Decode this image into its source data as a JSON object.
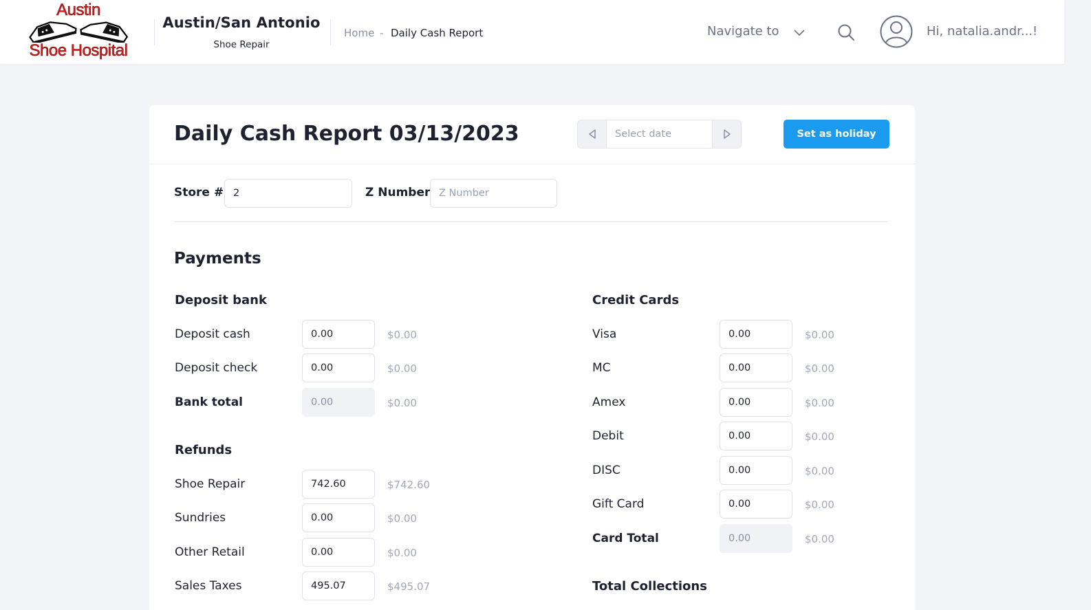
{
  "header": {
    "logo_top": "Austin",
    "logo_bottom": "Shoe Hospital",
    "brand_title": "Austin/San Antonio",
    "brand_subtitle": "Shoe Repair",
    "breadcrumb": {
      "home": "Home",
      "separator": "-",
      "current": "Daily Cash Report"
    },
    "navigate_label": "Navigate to",
    "greeting": "Hi, natalia.andr...!"
  },
  "report": {
    "title": "Daily Cash Report 03/13/2023",
    "date_placeholder": "Select date",
    "holiday_button": "Set as holiday",
    "store_label": "Store #",
    "store_value": "2",
    "z_label": "Z Number",
    "z_placeholder": "Z Number"
  },
  "payments": {
    "title": "Payments",
    "deposit_bank": {
      "title": "Deposit bank",
      "rows": [
        {
          "label": "Deposit cash",
          "value": "0.00",
          "amount": "$0.00"
        },
        {
          "label": "Deposit check",
          "value": "0.00",
          "amount": "$0.00"
        },
        {
          "label": "Bank total",
          "value": "0.00",
          "amount": "$0.00"
        }
      ]
    },
    "refunds": {
      "title": "Refunds",
      "rows": [
        {
          "label": "Shoe Repair",
          "value": "742.60",
          "amount": "$742.60"
        },
        {
          "label": "Sundries",
          "value": "0.00",
          "amount": "$0.00"
        },
        {
          "label": "Other Retail",
          "value": "0.00",
          "amount": "$0.00"
        },
        {
          "label": "Sales Taxes",
          "value": "495.07",
          "amount": "$495.07"
        }
      ]
    },
    "credit_cards": {
      "title": "Credit Cards",
      "rows": [
        {
          "label": "Visa",
          "value": "0.00",
          "amount": "$0.00"
        },
        {
          "label": "MC",
          "value": "0.00",
          "amount": "$0.00"
        },
        {
          "label": "Amex",
          "value": "0.00",
          "amount": "$0.00"
        },
        {
          "label": "Debit",
          "value": "0.00",
          "amount": "$0.00"
        },
        {
          "label": "DISC",
          "value": "0.00",
          "amount": "$0.00"
        },
        {
          "label": "Gift Card",
          "value": "0.00",
          "amount": "$0.00"
        },
        {
          "label": "Card Total",
          "value": "0.00",
          "amount": "$0.00"
        }
      ]
    },
    "total_collections_title": "Total Collections"
  },
  "colors": {
    "primary": "#1a9bf0",
    "logo_red": "#e01b1b",
    "background": "#f3f4f8"
  },
  "icons": [
    "logo-shoes-icon",
    "chevron-down-icon",
    "search-icon",
    "user-avatar-icon",
    "chevron-left-icon",
    "chevron-right-icon"
  ]
}
